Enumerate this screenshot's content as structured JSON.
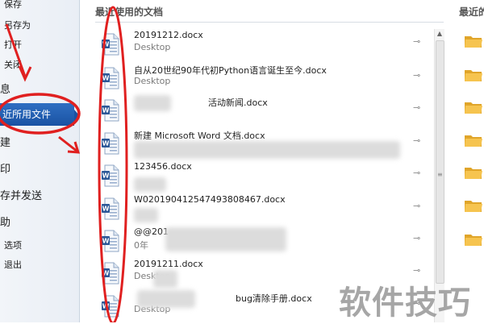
{
  "colors": {
    "accent": "#1a52a3",
    "annotation": "#e02020",
    "word_blue": "#2b5797"
  },
  "nav": {
    "items": [
      {
        "label": "保存",
        "style": "small"
      },
      {
        "label": "另存为",
        "style": "small"
      },
      {
        "label": "打开",
        "style": "small"
      },
      {
        "label": "关闭",
        "style": "small"
      },
      {
        "label": "息",
        "style": "big"
      },
      {
        "label": "近所用文件",
        "style": "active"
      },
      {
        "label": "建",
        "style": "big"
      },
      {
        "label": "印",
        "style": "big"
      },
      {
        "label": "存并发送",
        "style": "big"
      },
      {
        "label": "助",
        "style": "big"
      },
      {
        "label": "选项",
        "style": "small"
      },
      {
        "label": "退出",
        "style": "small"
      }
    ]
  },
  "recent": {
    "title": "最近使用的文档",
    "pin_icon": "pin-icon",
    "docs": [
      {
        "name": "20191212.docx",
        "location": "Desktop"
      },
      {
        "name": "自从20世纪90年代初Python语言诞生至今.docx",
        "location": "Desktop"
      },
      {
        "name": "活动新闻.docx",
        "location": ""
      },
      {
        "name": "新建 Microsoft Word 文档.docx",
        "location": ""
      },
      {
        "name": "123456.docx",
        "location": ""
      },
      {
        "name": "W020190412547493808467.docx",
        "location": ""
      },
      {
        "name": "@@201",
        "location": "0年"
      },
      {
        "name": "20191211.docx",
        "location": "Desktop"
      },
      {
        "name": "bug清除手册.docx",
        "location": "Desktop"
      }
    ]
  },
  "places": {
    "title": "最近的位置"
  },
  "watermark": "软件技巧"
}
